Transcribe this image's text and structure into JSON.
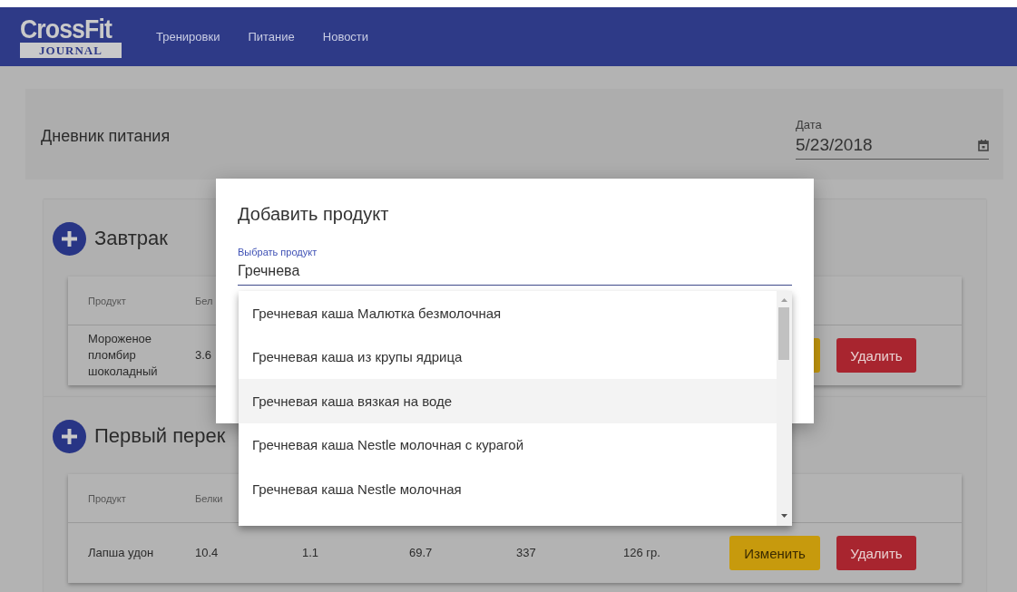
{
  "navbar": {
    "logo": {
      "top": "CrossFit",
      "bottom": "JOURNAL"
    },
    "links": [
      "Тренировки",
      "Питание",
      "Новости"
    ]
  },
  "diary": {
    "title": "Дневник питания",
    "date": {
      "label": "Дата",
      "value": "5/23/2018"
    }
  },
  "meals": [
    {
      "title": "Завтрак",
      "columns": [
        "Продукт",
        "Бел"
      ],
      "rows": [
        {
          "cells": [
            "Мороженое пломбир шоколадный",
            "3.6"
          ],
          "buttons": [
            {
              "kind": "edit"
            },
            {
              "kind": "delete",
              "label": "Удалить"
            }
          ]
        }
      ]
    },
    {
      "title": "Первый перек",
      "columns": [
        "Продукт",
        "Белки"
      ],
      "rows": [
        {
          "cells": [
            "Лапша удон",
            "10.4",
            "1.1",
            "69.7",
            "337",
            "126 гр."
          ],
          "buttons": [
            {
              "kind": "edit",
              "label": "Изменить"
            },
            {
              "kind": "delete",
              "label": "Удалить"
            }
          ]
        }
      ]
    }
  ],
  "dialog": {
    "title": "Добавить продукт",
    "field": {
      "label": "Выбрать продукт",
      "value": "Гречнева"
    },
    "options": [
      {
        "label": "Гречневая каша Малютка безмолочная",
        "selected": false
      },
      {
        "label": "Гречневая каша из крупы ядрица",
        "selected": false
      },
      {
        "label": "Гречневая каша вязкая на воде",
        "selected": true
      },
      {
        "label": "Гречневая каша Nestle молочная с курагой",
        "selected": false
      },
      {
        "label": "Гречневая каша Nestle молочная",
        "selected": false
      }
    ]
  }
}
